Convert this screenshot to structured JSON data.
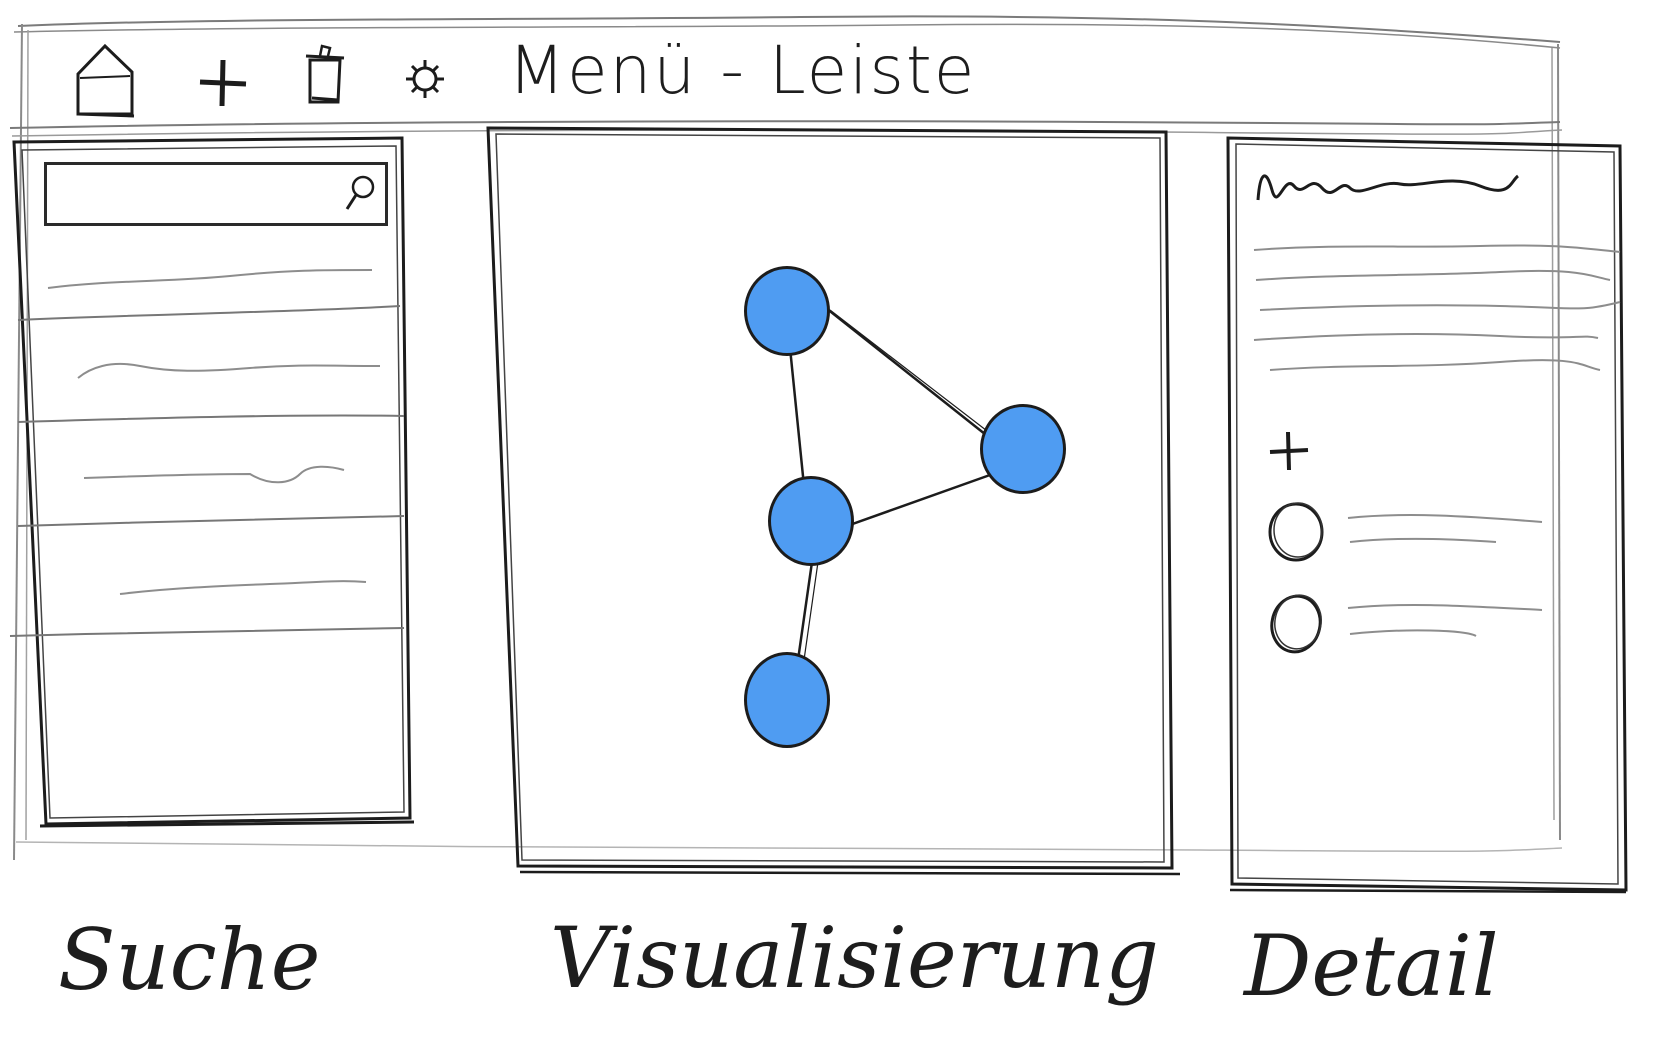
{
  "menu_bar": {
    "title": "Menü - Leiste",
    "icons": [
      "home-icon",
      "add-icon",
      "delete-icon",
      "settings-icon"
    ]
  },
  "search_panel": {
    "caption": "Suche",
    "search": {
      "value": "",
      "placeholder": ""
    },
    "search_icon": "magnifier-icon",
    "results_count": 4
  },
  "visualization_panel": {
    "caption": "Visualisierung",
    "node_color": "#4f9cf2",
    "nodes": [
      "node-a",
      "node-b",
      "node-c",
      "node-d"
    ],
    "edges": [
      [
        "node-a",
        "node-b"
      ],
      [
        "node-a",
        "node-c"
      ],
      [
        "node-c",
        "node-b"
      ],
      [
        "node-c",
        "node-d"
      ]
    ]
  },
  "detail_panel": {
    "caption": "Detail",
    "add_icon": "plus-icon",
    "options": [
      "radio-option-1",
      "radio-option-2"
    ]
  },
  "colors": {
    "pencil": "#1c1c1c",
    "sketch_gray": "#9a9a9a",
    "node_fill": "#4f9cf2"
  }
}
